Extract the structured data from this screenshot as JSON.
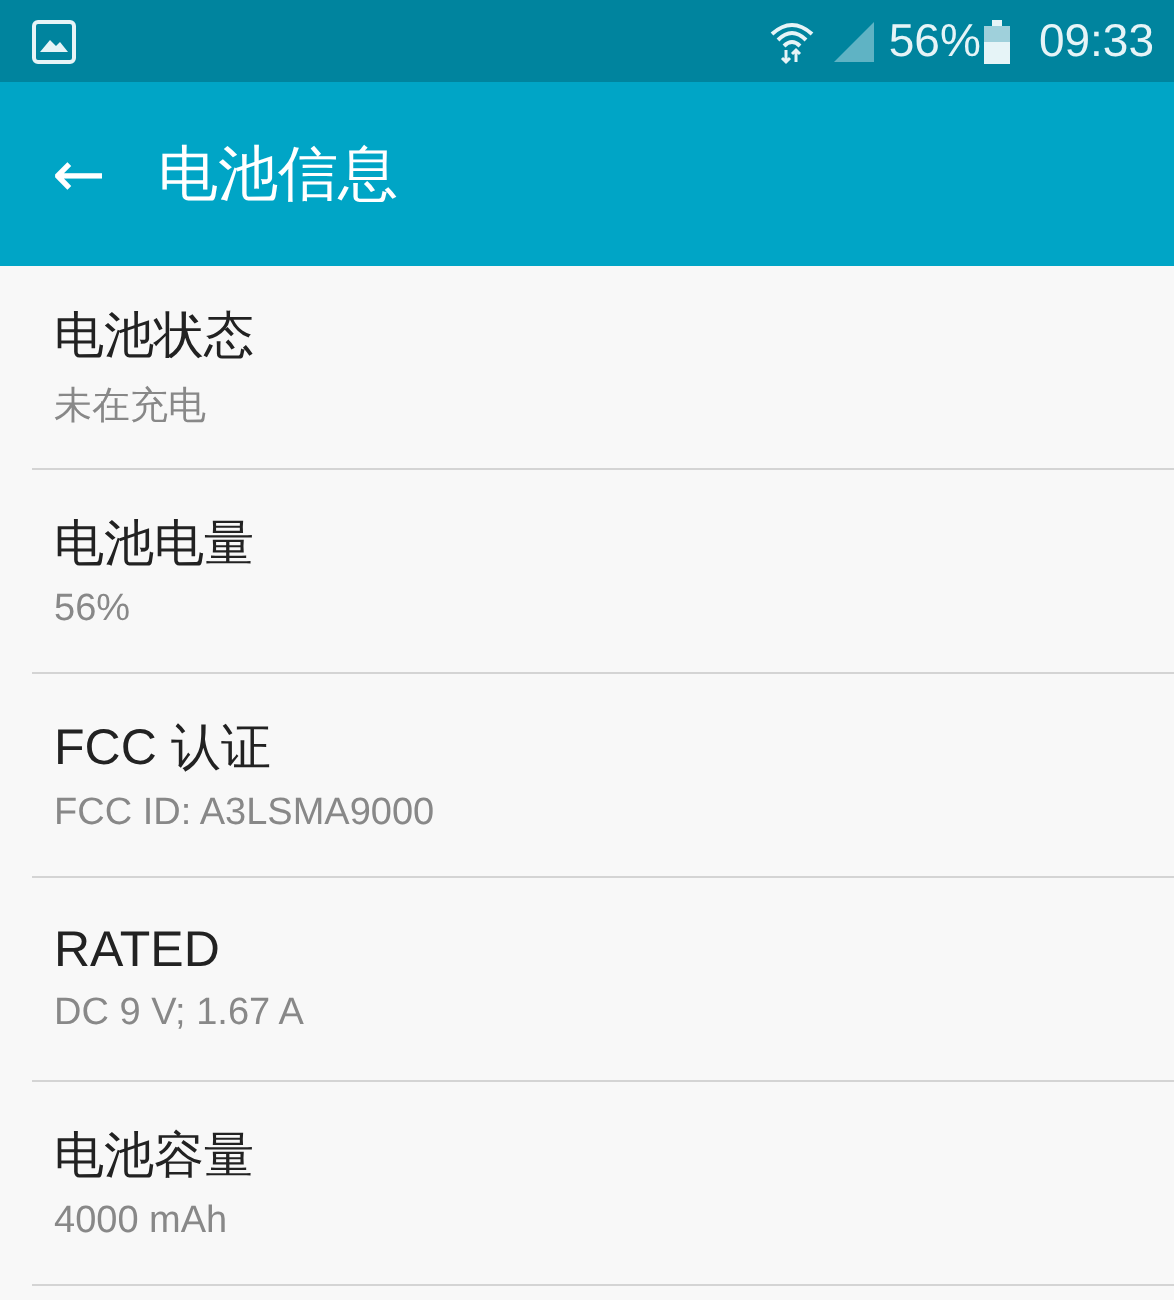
{
  "status_bar": {
    "battery": "56%",
    "time": "09:33"
  },
  "app_bar": {
    "back": "←",
    "title": "电池信息"
  },
  "items": [
    {
      "title": "电池状态",
      "value": "未在充电"
    },
    {
      "title": "电池电量",
      "value": "56%"
    },
    {
      "title": "FCC 认证",
      "value": "FCC ID: A3LSMA9000"
    },
    {
      "title": "RATED",
      "value": "DC 9 V; 1.67 A"
    },
    {
      "title": "电池容量",
      "value": "4000 mAh"
    }
  ]
}
